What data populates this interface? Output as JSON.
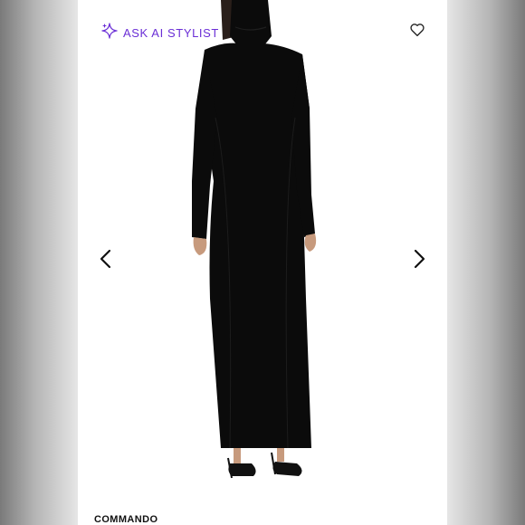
{
  "stylist": {
    "label": "ASK AI STYLIST",
    "accent": "#6b2fd6"
  },
  "product": {
    "brand": "COMMANDO"
  },
  "icons": {
    "sparkle": "sparkle-icon",
    "heart": "heart-icon",
    "prev": "chevron-left-icon",
    "next": "chevron-right-icon"
  },
  "colors": {
    "background": "#ffffff",
    "garment": "#0b0b0b"
  }
}
